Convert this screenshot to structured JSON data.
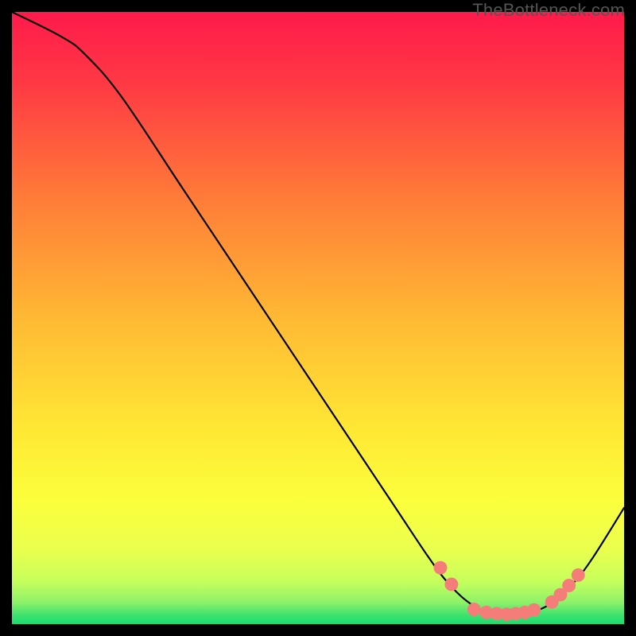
{
  "watermark": "TheBottleneck.com",
  "chart_data": {
    "type": "line",
    "title": "",
    "xlabel": "",
    "ylabel": "",
    "xlim": [
      0,
      100
    ],
    "ylim": [
      0,
      100
    ],
    "background_gradient": {
      "top": "#ff1a4b",
      "mid_upper": "#ff8a33",
      "mid": "#ffe734",
      "low": "#f7ff52",
      "bottom": "#22e06e"
    },
    "curve": {
      "color": "#000000",
      "points": [
        {
          "x": 0,
          "y": 100
        },
        {
          "x": 8,
          "y": 96
        },
        {
          "x": 12,
          "y": 93
        },
        {
          "x": 18,
          "y": 86
        },
        {
          "x": 28,
          "y": 71
        },
        {
          "x": 40,
          "y": 53
        },
        {
          "x": 52,
          "y": 35
        },
        {
          "x": 62,
          "y": 20
        },
        {
          "x": 68,
          "y": 11
        },
        {
          "x": 71,
          "y": 7
        },
        {
          "x": 74,
          "y": 4
        },
        {
          "x": 77,
          "y": 2.2
        },
        {
          "x": 80,
          "y": 1.7
        },
        {
          "x": 83,
          "y": 1.7
        },
        {
          "x": 86,
          "y": 2.3
        },
        {
          "x": 89,
          "y": 4
        },
        {
          "x": 92,
          "y": 7
        },
        {
          "x": 95,
          "y": 11
        },
        {
          "x": 100,
          "y": 19
        }
      ]
    },
    "markers": {
      "color": "#f47d79",
      "radius": 1.1,
      "points": [
        {
          "x": 70,
          "y": 9.2
        },
        {
          "x": 71.8,
          "y": 6.5
        },
        {
          "x": 75.5,
          "y": 2.4
        },
        {
          "x": 77.5,
          "y": 1.9
        },
        {
          "x": 79.2,
          "y": 1.7
        },
        {
          "x": 80.8,
          "y": 1.6
        },
        {
          "x": 82.3,
          "y": 1.7
        },
        {
          "x": 83.8,
          "y": 1.9
        },
        {
          "x": 85.3,
          "y": 2.3
        },
        {
          "x": 88.2,
          "y": 3.6
        },
        {
          "x": 89.6,
          "y": 4.8
        },
        {
          "x": 91.0,
          "y": 6.3
        },
        {
          "x": 92.5,
          "y": 8.0
        }
      ]
    }
  }
}
